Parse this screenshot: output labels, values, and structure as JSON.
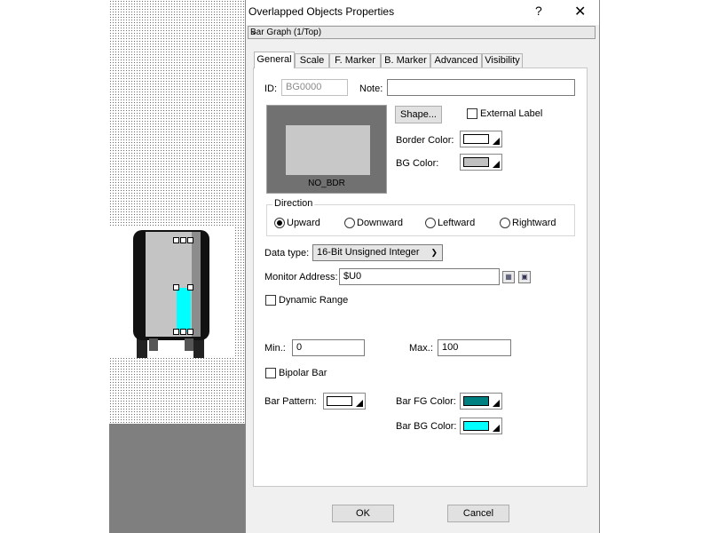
{
  "dialog": {
    "title": "Overlapped Objects Properties",
    "help_label": "?",
    "close_label": "✕",
    "object_selector": {
      "value": "Bar Graph (1/Top)"
    }
  },
  "tabs": [
    {
      "label": "General",
      "active": true
    },
    {
      "label": "Scale",
      "active": false
    },
    {
      "label": "F. Marker",
      "active": false
    },
    {
      "label": "B. Marker",
      "active": false
    },
    {
      "label": "Advanced",
      "active": false
    },
    {
      "label": "Visibility",
      "active": false
    }
  ],
  "general": {
    "id_label": "ID:",
    "id_value": "BG0000",
    "note_label": "Note:",
    "note_value": "",
    "shape_button": "Shape...",
    "external_label": "External Label",
    "preview_caption": "NO_BDR",
    "border_color_label": "Border Color:",
    "bg_color_label": "BG Color:",
    "direction": {
      "title": "Direction",
      "options": [
        "Upward",
        "Downward",
        "Leftward",
        "Rightward"
      ],
      "selected": "Upward"
    },
    "data_type_label": "Data type:",
    "data_type_value": "16-Bit Unsigned Integer",
    "monitor_address_label": "Monitor Address:",
    "monitor_address_value": "$U0",
    "dynamic_range_label": "Dynamic Range",
    "min_label": "Min.:",
    "min_value": "0",
    "max_label": "Max.:",
    "max_value": "100",
    "bipolar_bar_label": "Bipolar Bar",
    "bar_pattern_label": "Bar Pattern:",
    "bar_fg_color_label": "Bar FG Color:",
    "bar_bg_color_label": "Bar BG Color:"
  },
  "colors": {
    "border_color": "#ffffff",
    "bg_color": "#c0c0c0",
    "bar_pattern": "#ffffff",
    "bar_fg_color": "#008080",
    "bar_bg_color": "#00ffff"
  },
  "footer": {
    "ok_label": "OK",
    "cancel_label": "Cancel"
  }
}
